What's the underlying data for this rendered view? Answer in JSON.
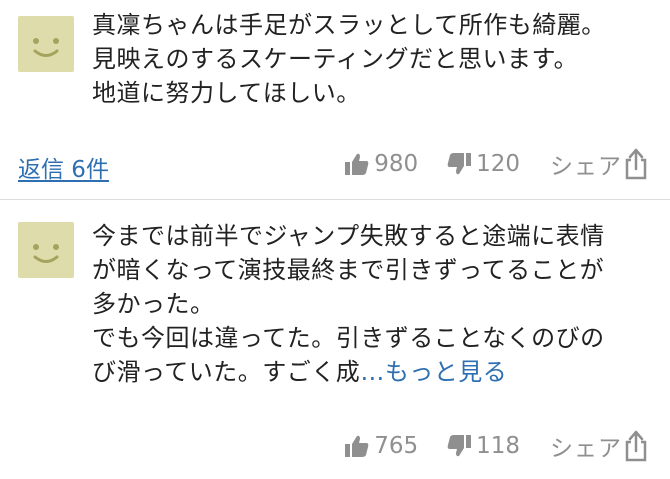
{
  "comments": [
    {
      "avatar_icon": "smiley-face-icon",
      "lines": [
        "真凜ちゃんは手足がスラッとして所作も綺麗。",
        "見映えのするスケーティングだと思います。",
        "地道に努力してほしい。"
      ],
      "reply_label": "返信 6件",
      "likes": "980",
      "dislikes": "120",
      "share_label": "シェア"
    },
    {
      "avatar_icon": "smiley-face-icon",
      "lines": [
        "今までは前半でジャンプ失敗すると途端に表情",
        "が暗くなって演技最終まで引きずってることが",
        "多かった。",
        "でも今回は違ってた。引きずることなくのびの"
      ],
      "last_line_text": "び滑っていた。すごく成",
      "more_label": "…もっと見る",
      "likes": "765",
      "dislikes": "118",
      "share_label": "シェア"
    }
  ],
  "colors": {
    "avatar_bg": "#dedcaa",
    "avatar_fg": "#a6a35f",
    "link": "#2e6fb2",
    "meta": "#8f8f8f",
    "divider": "#dcdcdc"
  }
}
